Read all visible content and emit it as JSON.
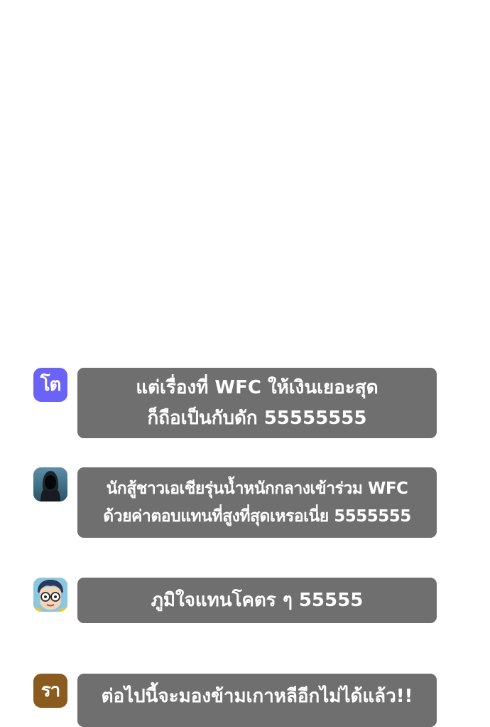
{
  "comments": [
    {
      "avatar_text": "โต",
      "avatar_color": "#6b63f6",
      "lines": [
        "แต่เรื่องที่ WFC ให้เงินเยอะสุด",
        "ก็ถือเป็นกับดัก 55555555"
      ]
    },
    {
      "avatar_icon": "hooded-person-avatar",
      "avatar_color": "#3d6f84",
      "lines": [
        "นักสู้ชาวเอเชียรุ่นน้ำหนักกลางเข้าร่วม WFC",
        "ด้วยค่าตอบแทนที่สูงที่สุดเหรอเนี่ย 5555555"
      ]
    },
    {
      "avatar_icon": "glasses-character-avatar",
      "avatar_color": "#5aa0c8",
      "lines": [
        "ภูมิใจแทนโคตร ๆ 55555"
      ]
    },
    {
      "avatar_text": "รา",
      "avatar_color": "#8b5a1e",
      "lines": [
        "ต่อไปนี้จะมองข้ามเกาหลีอีกไม่ได้แล้ว!!"
      ]
    }
  ],
  "bubble_color": "#6f6f6f"
}
